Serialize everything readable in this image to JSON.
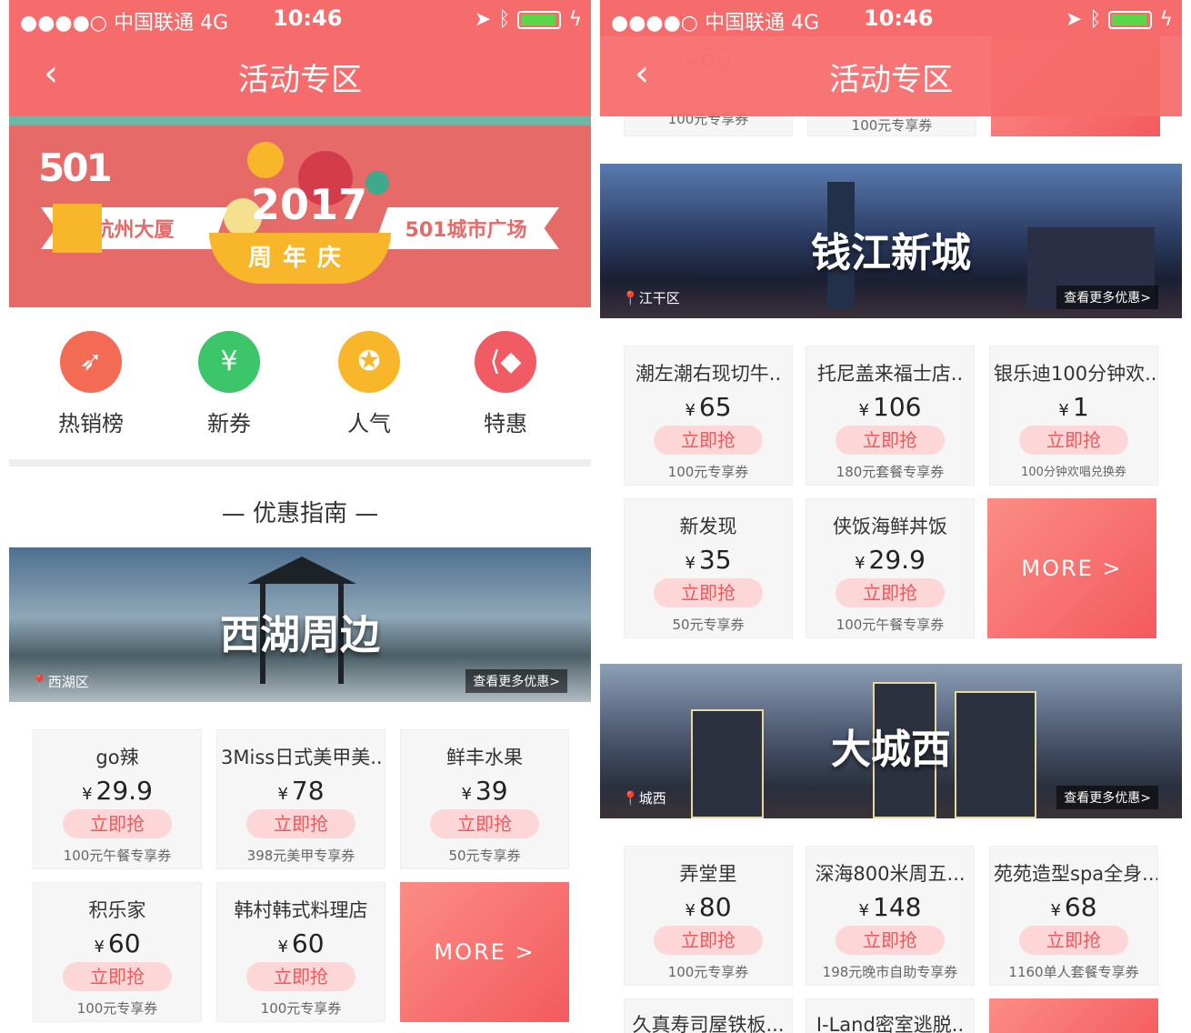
{
  "status": {
    "carrier": "●●●●○ 中国联通  4G",
    "time": "10:46"
  },
  "nav": {
    "title": "活动专区",
    "back_glyph": "‹"
  },
  "hero": {
    "logo": "501",
    "left_ribbon": "杭州大厦",
    "right_ribbon": "501城市广场",
    "year": "2017",
    "anniversary": "周年庆"
  },
  "categories": [
    {
      "label": "热销榜",
      "icon": "rocket-icon",
      "color": "#f46b55",
      "glyph": "🚀"
    },
    {
      "label": "新券",
      "icon": "ticket-icon",
      "color": "#3dc56a",
      "glyph": "¥"
    },
    {
      "label": "人气",
      "icon": "medal-icon",
      "color": "#f8b72b",
      "glyph": "✪"
    },
    {
      "label": "特惠",
      "icon": "tag-icon",
      "color": "#f05b64",
      "glyph": "⟨"
    }
  ],
  "section_title": "— 优惠指南 —",
  "areas": {
    "westlake": {
      "name": "西湖周边",
      "location": "西湖区",
      "more": "查看更多优惠>"
    },
    "qianjiang": {
      "name": "钱江新城",
      "location": "江干区",
      "more": "查看更多优惠>"
    },
    "chengxi": {
      "name": "大城西",
      "location": "城西",
      "more": "查看更多优惠>"
    }
  },
  "westlake_deals": [
    {
      "name": "go辣",
      "price": "29.9",
      "button": "立即抢",
      "desc": "100元午餐专享券"
    },
    {
      "name": "3Miss日式美甲美..",
      "price": "78",
      "button": "立即抢",
      "desc": "398元美甲专享券"
    },
    {
      "name": "鲜丰水果",
      "price": "39",
      "button": "立即抢",
      "desc": "50元专享券"
    },
    {
      "name": "积乐家",
      "price": "60",
      "button": "立即抢",
      "desc": "100元专享券"
    },
    {
      "name": "韩村韩式料理店",
      "price": "60",
      "button": "立即抢",
      "desc": "100元专享券"
    }
  ],
  "qianjiang_deals": [
    {
      "name": "潮左潮右现切牛..",
      "price": "65",
      "button": "立即抢",
      "desc": "100元专享券"
    },
    {
      "name": "托尼盖来福士店..",
      "price": "106",
      "button": "立即抢",
      "desc": "180元套餐专享券"
    },
    {
      "name": "银乐迪100分钟欢..",
      "price": "1",
      "button": "立即抢",
      "desc": "100分钟欢唱兑换券"
    },
    {
      "name": "新发现",
      "price": "35",
      "button": "立即抢",
      "desc": "50元专享券"
    },
    {
      "name": "侠饭海鲜丼饭",
      "price": "29.9",
      "button": "立即抢",
      "desc": "100元午餐专享券"
    }
  ],
  "chengxi_deals": [
    {
      "name": "弄堂里",
      "price": "80",
      "button": "立即抢",
      "desc": "100元专享券"
    },
    {
      "name": "深海800米周五...",
      "price": "148",
      "button": "立即抢",
      "desc": "198元晚市自助专享券"
    },
    {
      "name": "苑苑造型spa全身...",
      "price": "68",
      "button": "立即抢",
      "desc": "1160单人套餐专享券"
    },
    {
      "name": "久真寿司屋铁板...",
      "price": "",
      "button": "",
      "desc": ""
    },
    {
      "name": "I-Land密室逃脱..",
      "price": "",
      "button": "",
      "desc": ""
    }
  ],
  "scrolled_top": {
    "price_a": "60",
    "desc_a": "100元专享券",
    "desc_b": "100元专享券"
  },
  "currency": "¥",
  "more_label": "MORE >"
}
